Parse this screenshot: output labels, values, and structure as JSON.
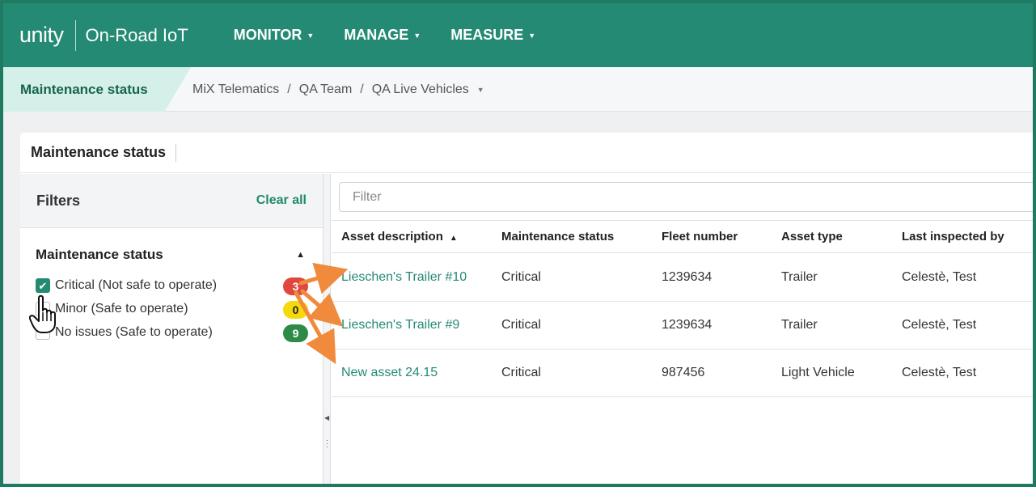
{
  "app": {
    "logo": "unity",
    "product": "On-Road IoT",
    "nav": [
      {
        "label": "MONITOR"
      },
      {
        "label": "MANAGE"
      },
      {
        "label": "MEASURE"
      }
    ]
  },
  "breadcrumb": {
    "active": "Maintenance status",
    "items": [
      "MiX Telematics",
      "QA Team",
      "QA Live Vehicles"
    ],
    "separator": "/"
  },
  "card": {
    "title": "Maintenance status"
  },
  "filters": {
    "title": "Filters",
    "clear_all": "Clear all",
    "group": {
      "title": "Maintenance status",
      "options": [
        {
          "label": "Critical (Not safe to operate)",
          "count": "3",
          "checked": true,
          "badge_color": "#e0483f",
          "badge_text_color": "#ffffff"
        },
        {
          "label": "Minor (Safe to operate)",
          "count": "0",
          "checked": false,
          "badge_color": "#f5d90a",
          "badge_text_color": "#222222"
        },
        {
          "label": "No issues (Safe to operate)",
          "count": "9",
          "checked": false,
          "badge_color": "#2e8b47",
          "badge_text_color": "#ffffff"
        }
      ]
    }
  },
  "grid": {
    "filter_placeholder": "Filter",
    "columns": [
      "Asset description",
      "Maintenance status",
      "Fleet number",
      "Asset type",
      "Last inspected by"
    ],
    "rows": [
      {
        "asset": "Lieschen's Trailer #10",
        "status": "Critical",
        "fleet": "1239634",
        "type": "Trailer",
        "inspected_by": "Celestè, Test"
      },
      {
        "asset": "Lieschen's Trailer #9",
        "status": "Critical",
        "fleet": "1239634",
        "type": "Trailer",
        "inspected_by": "Celestè, Test"
      },
      {
        "asset": "New asset 24.15",
        "status": "Critical",
        "fleet": "987456",
        "type": "Light Vehicle",
        "inspected_by": "Celestè, Test"
      }
    ]
  },
  "colors": {
    "brand": "#258a74",
    "annotation_arrow": "#f08a3c"
  },
  "icons": {
    "nav_caret": "caret-down-icon",
    "sort": "sort-ascending-icon",
    "collapse": "caret-up-icon",
    "checkbox_check": "check-icon",
    "cursor": "hand-pointer-icon",
    "annotation": "arrow-icon"
  }
}
